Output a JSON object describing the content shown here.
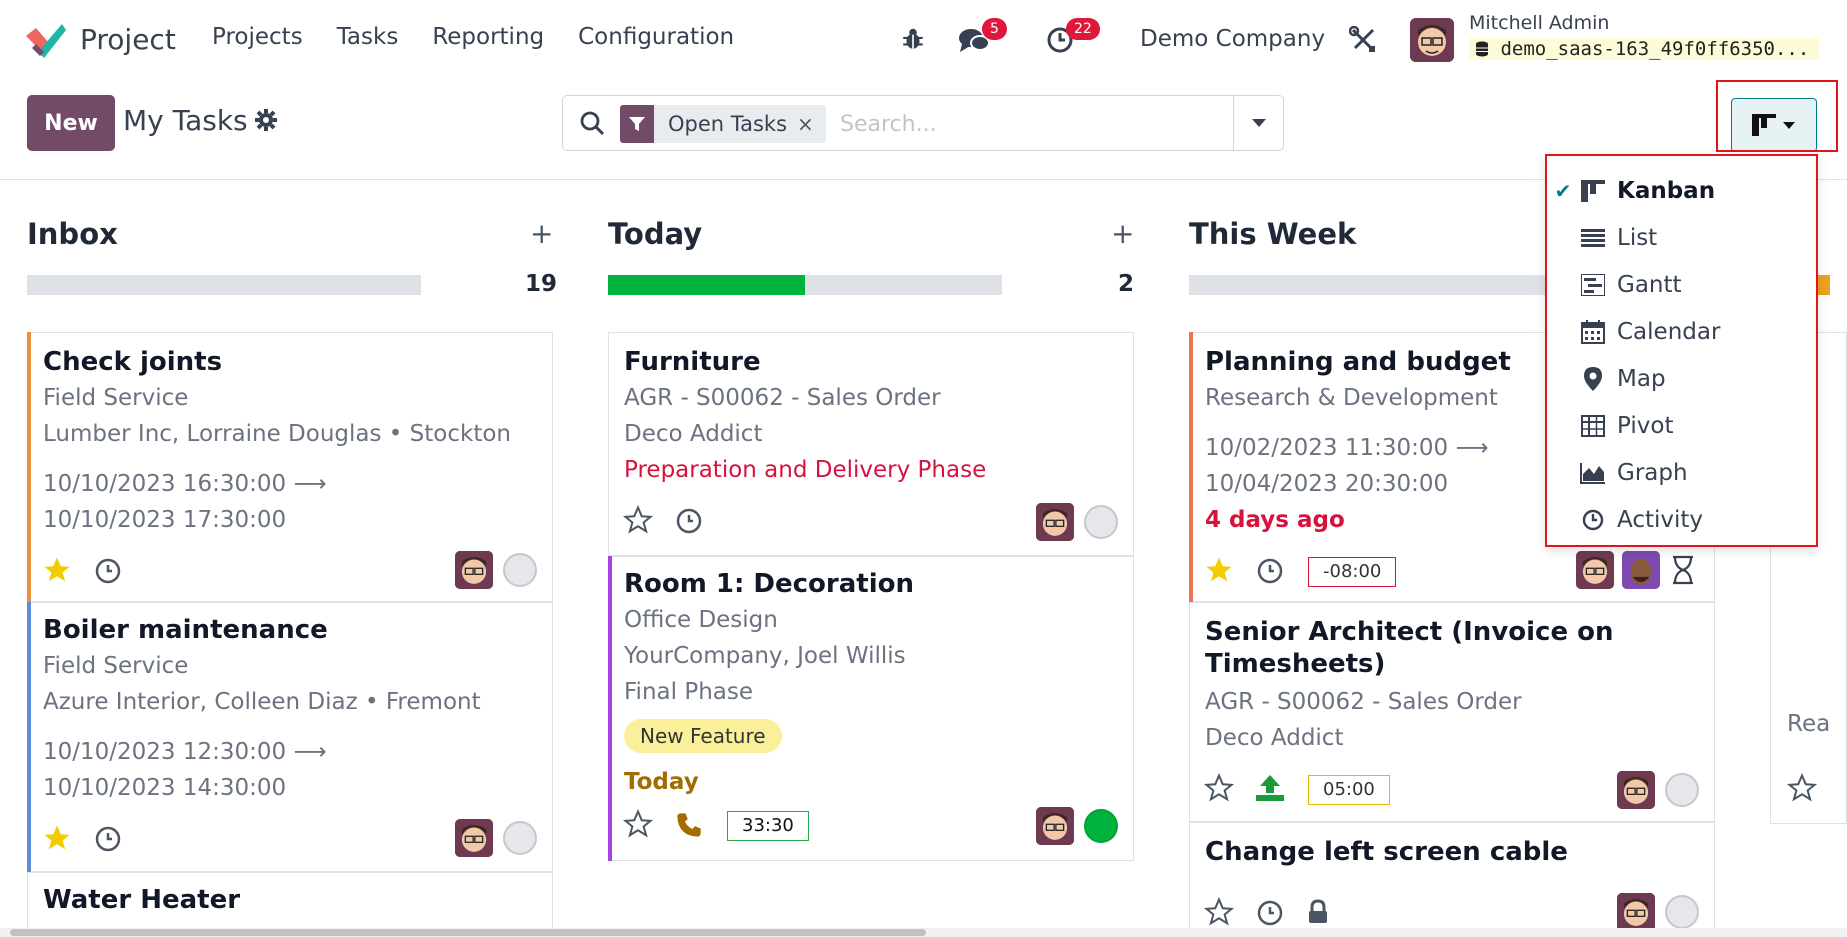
{
  "navbar": {
    "app_name": "Project",
    "menu": [
      "Projects",
      "Tasks",
      "Reporting",
      "Configuration"
    ],
    "messages_count": "5",
    "activities_count": "22",
    "company": "Demo Company",
    "user_name": "Mitchell Admin",
    "database": "demo_saas-163_49f0ff6350..."
  },
  "control": {
    "new_label": "New",
    "title": "My Tasks",
    "facet_label": "Open Tasks",
    "facet_remove": "×",
    "search_placeholder": "Search..."
  },
  "columns": [
    {
      "title": "Inbox",
      "count": "19",
      "progress": 0,
      "cards": [
        {
          "title": "Check joints",
          "line1": "Field Service",
          "line2": "Lumber Inc, Lorraine Douglas • Stockton",
          "date1": "10/10/2023 16:30:00",
          "date2": "10/10/2023 17:30:00",
          "starred": true,
          "stripe": "#e8903a"
        },
        {
          "title": "Boiler maintenance",
          "line1": "Field Service",
          "line2": "Azure Interior, Colleen Diaz • Fremont",
          "date1": "10/10/2023 12:30:00",
          "date2": "10/10/2023 14:30:00",
          "starred": true,
          "stripe": "#5c8ed8"
        },
        {
          "title": "Water Heater"
        }
      ]
    },
    {
      "title": "Today",
      "count": "2",
      "progress": 0.5,
      "cards": [
        {
          "title": "Furniture",
          "line1": "AGR - S00062 - Sales Order",
          "line2": "Deco Addict",
          "line3": "Preparation and Delivery Phase"
        },
        {
          "title": "Room 1: Decoration",
          "line1": "Office Design",
          "line2": "YourCompany, Joel Willis",
          "line3": "Final Phase",
          "tag": "New Feature",
          "deadline": "Today",
          "time": "33:30",
          "stripe": "#a542e8"
        }
      ]
    },
    {
      "title": "This Week",
      "progress": 0,
      "cards": [
        {
          "title": "Planning and budget",
          "line1": "Research & Development",
          "date1": "10/02/2023 11:30:00",
          "date2": "10/04/2023 20:30:00",
          "deadline": "4 days ago",
          "time": "-08:00",
          "starred": true,
          "stripe": "#e8754f"
        },
        {
          "title": "Senior Architect (Invoice on",
          "title2": "Timesheets)",
          "line1": "AGR - S00062 - Sales Order",
          "line2": "Deco Addict",
          "time": "05:00"
        },
        {
          "title": "Change left screen cable"
        }
      ]
    }
  ],
  "partial_column": {
    "line": "Rea"
  },
  "view_switcher": {
    "items": [
      {
        "label": "Kanban",
        "icon": "kanban-icon",
        "active": true
      },
      {
        "label": "List",
        "icon": "list-icon"
      },
      {
        "label": "Gantt",
        "icon": "gantt-icon"
      },
      {
        "label": "Calendar",
        "icon": "calendar-icon"
      },
      {
        "label": "Map",
        "icon": "map-pin-icon"
      },
      {
        "label": "Pivot",
        "icon": "pivot-icon"
      },
      {
        "label": "Graph",
        "icon": "area-chart-icon"
      },
      {
        "label": "Activity",
        "icon": "clock-icon"
      }
    ]
  },
  "colors": {
    "brand": "#714b67",
    "accent": "#017e84",
    "danger": "#d6123d",
    "success": "#00b33c"
  }
}
